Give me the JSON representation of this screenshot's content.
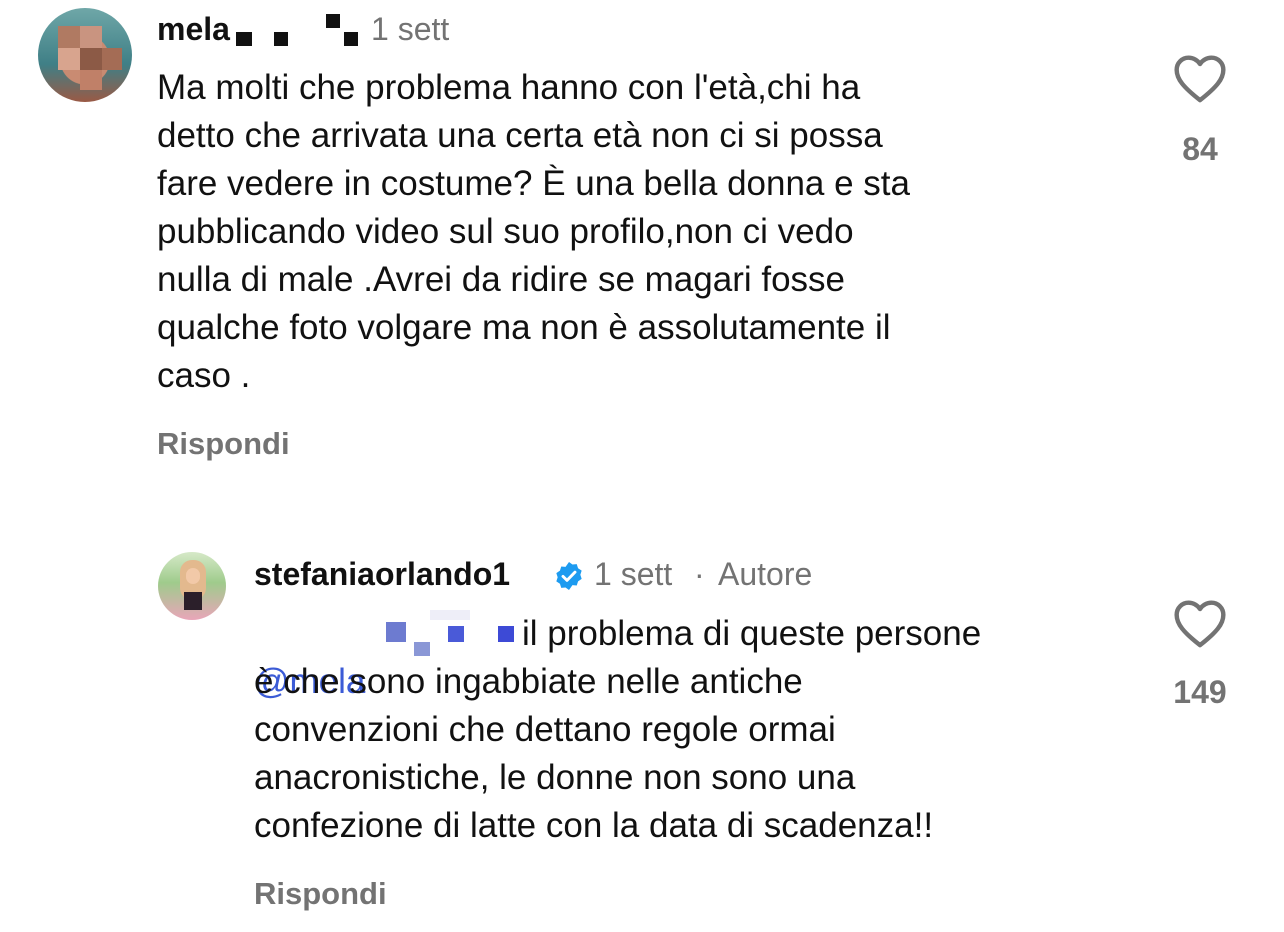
{
  "comment": {
    "username": "mela",
    "time": "1 sett",
    "text": "Ma molti che problema hanno con l'età,chi ha\ndetto che arrivata una certa età non ci si possa\nfare vedere in costume? È una bella donna e sta\npubblicando video sul suo profilo,non ci vedo\nnulla di male .Avrei da ridire se magari fosse\nqualche foto volgare  ma non è assolutamente il\ncaso .",
    "reply_label": "Rispondi",
    "likes": "84"
  },
  "reply": {
    "username": "stefaniaorlando1",
    "time": "1 sett",
    "separator": "·",
    "author_badge": "Autore",
    "mention": "@mela",
    "text_first": "il problema di queste persone",
    "text_rest": "è che sono ingabbiate nelle antiche\nconvenzioni che dettano regole ormai\nanacronistiche, le donne non sono una\nconfezione di latte con la data di scadenza!!",
    "reply_label": "Rispondi",
    "likes": "149"
  },
  "icons": {
    "like": "heart-outline-icon",
    "verified": "verified-badge-icon"
  },
  "colors": {
    "accent_verified": "#1d9bf0",
    "mention": "#3b5bd6",
    "secondary_text": "#737373"
  }
}
